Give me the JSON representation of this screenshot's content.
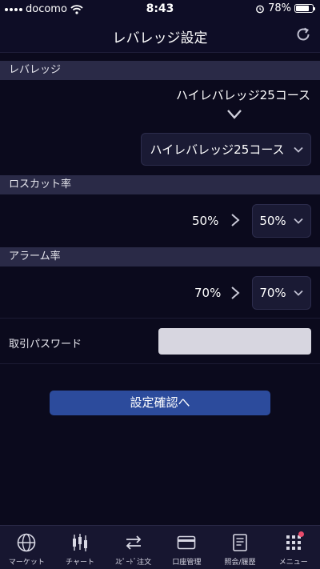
{
  "status_bar": {
    "carrier": "docomo",
    "time": "8:43",
    "battery": "78%",
    "battery_level": 0.78
  },
  "header": {
    "title": "レバレッジ設定"
  },
  "leverage": {
    "section_label": "レバレッジ",
    "current": "ハイレバレッジ25コース",
    "selected": "ハイレバレッジ25コース"
  },
  "losscut": {
    "section_label": "ロスカット率",
    "current": "50%",
    "selected": "50%"
  },
  "alarm": {
    "section_label": "アラーム率",
    "current": "70%",
    "selected": "70%"
  },
  "password": {
    "label": "取引パスワード",
    "value": ""
  },
  "confirm_button": {
    "label": "設定確認へ"
  },
  "tab_bar": {
    "items": [
      {
        "label": "マーケット",
        "icon": "globe-icon"
      },
      {
        "label": "チャート",
        "icon": "candlestick-icon"
      },
      {
        "label": "ｽﾋﾟｰﾄﾞ注文",
        "icon": "swap-arrows-icon"
      },
      {
        "label": "口座管理",
        "icon": "card-icon"
      },
      {
        "label": "照会/履歴",
        "icon": "document-icon"
      },
      {
        "label": "メニュー",
        "icon": "grid-icon"
      }
    ]
  },
  "colors": {
    "background": "#0b0a1d",
    "section": "#2a2a47",
    "accent": "#2c4b9c",
    "badge": "#e94a6a"
  }
}
